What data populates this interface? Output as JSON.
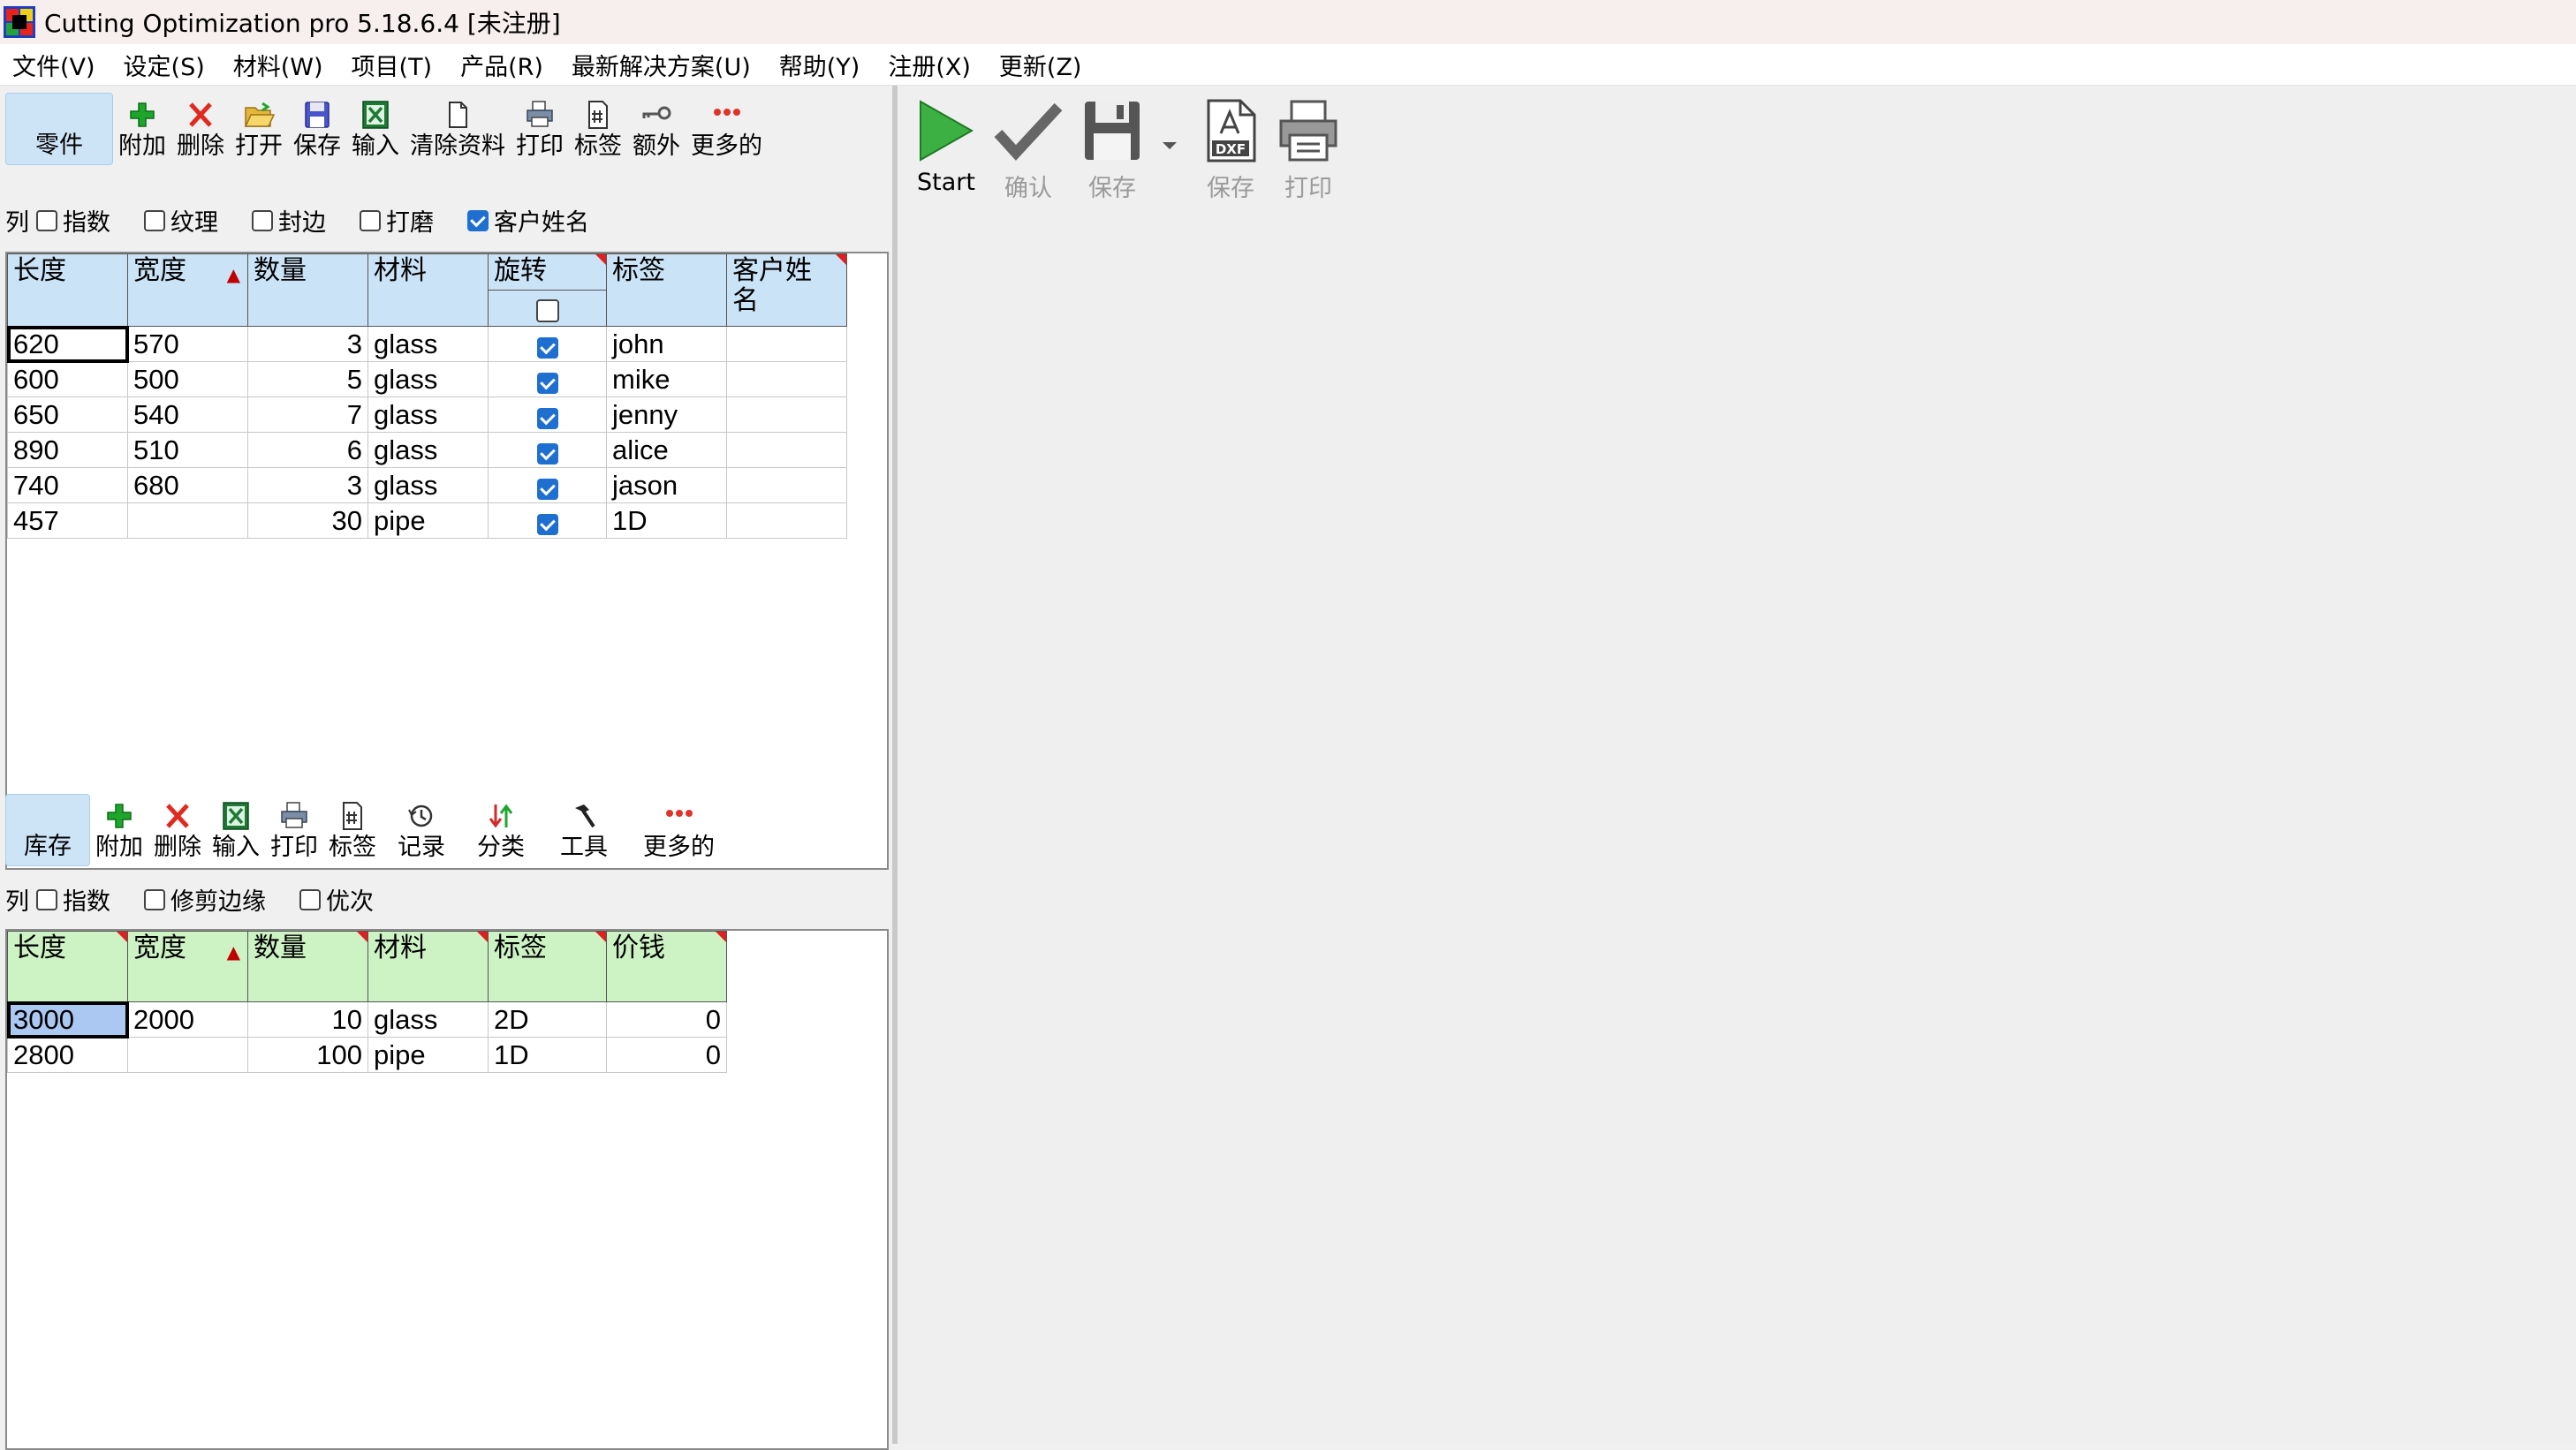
{
  "app": {
    "title": "Cutting Optimization pro 5.18.6.4 [未注册]"
  },
  "menu": [
    "文件(V)",
    "设定(S)",
    "材料(W)",
    "项目(T)",
    "产品(R)",
    "最新解决方案(U)",
    "帮助(Y)",
    "注册(X)",
    "更新(Z)"
  ],
  "parts_toolbar": {
    "active": "零件",
    "add": "附加",
    "delete": "删除",
    "open": "打开",
    "save": "保存",
    "import": "输入",
    "clear": "清除资料",
    "print": "打印",
    "label": "标签",
    "extra": "额外",
    "more": "更多的"
  },
  "parts_options": {
    "col_label": "列",
    "items": [
      {
        "label": "指数",
        "checked": false
      },
      {
        "label": "纹理",
        "checked": false
      },
      {
        "label": "封边",
        "checked": false
      },
      {
        "label": "打磨",
        "checked": false
      },
      {
        "label": "客户姓名",
        "checked": true
      }
    ]
  },
  "parts_table": {
    "headers": [
      "长度",
      "宽度",
      "数量",
      "材料",
      "旋转",
      "标签",
      "客户姓名"
    ],
    "header_col7_l1": "客户姓",
    "header_col7_l2": "名",
    "rows": [
      {
        "length": "620",
        "width": "570",
        "qty": "3",
        "material": "glass",
        "rotate": true,
        "label": "john",
        "customer": ""
      },
      {
        "length": "600",
        "width": "500",
        "qty": "5",
        "material": "glass",
        "rotate": true,
        "label": "mike",
        "customer": ""
      },
      {
        "length": "650",
        "width": "540",
        "qty": "7",
        "material": "glass",
        "rotate": true,
        "label": "jenny",
        "customer": ""
      },
      {
        "length": "890",
        "width": "510",
        "qty": "6",
        "material": "glass",
        "rotate": true,
        "label": "alice",
        "customer": ""
      },
      {
        "length": "740",
        "width": "680",
        "qty": "3",
        "material": "glass",
        "rotate": true,
        "label": "jason",
        "customer": ""
      },
      {
        "length": "457",
        "width": "",
        "qty": "30",
        "material": "pipe",
        "rotate": true,
        "label": "1D",
        "customer": ""
      }
    ]
  },
  "stock_toolbar": {
    "active": "库存",
    "add": "附加",
    "delete": "删除",
    "import": "输入",
    "print": "打印",
    "label": "标签",
    "record": "记录",
    "sort": "分类",
    "tools": "工具",
    "more": "更多的"
  },
  "stock_options": {
    "col_label": "列",
    "items": [
      {
        "label": "指数",
        "checked": false
      },
      {
        "label": "修剪边缘",
        "checked": false
      },
      {
        "label": "优次",
        "checked": false
      }
    ]
  },
  "stock_table": {
    "headers": [
      "长度",
      "宽度",
      "数量",
      "材料",
      "标签",
      "价钱"
    ],
    "rows": [
      {
        "length": "3000",
        "width": "2000",
        "qty": "10",
        "material": "glass",
        "label": "2D",
        "price": "0"
      },
      {
        "length": "2800",
        "width": "",
        "qty": "100",
        "material": "pipe",
        "label": "1D",
        "price": "0"
      }
    ]
  },
  "result_toolbar": {
    "start": "Start",
    "confirm": "确认",
    "save": "保存",
    "save_dxf": "保存",
    "print": "打印",
    "dxf_text": "DXF"
  }
}
